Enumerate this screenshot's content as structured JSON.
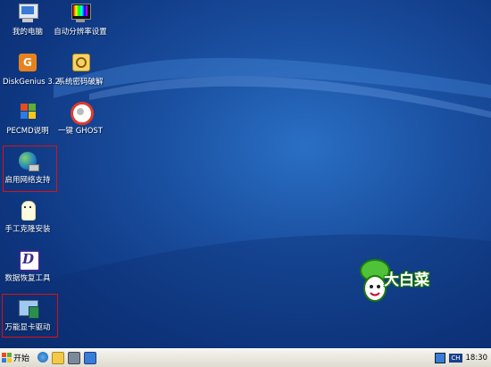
{
  "desktop": {
    "icons": [
      {
        "label": "我的电脑",
        "icon": "my-computer-icon"
      },
      {
        "label": "自动分辨率设置",
        "icon": "resolution-icon"
      },
      {
        "label": "DiskGenius 3.2",
        "icon": "diskgenius-icon"
      },
      {
        "label": "系统密码破解",
        "icon": "password-icon"
      },
      {
        "label": "PECMD说明",
        "icon": "windows-flag-icon"
      },
      {
        "label": "一键 GHOST",
        "icon": "ghost-icon"
      },
      {
        "label": "启用网络支持",
        "icon": "network-globe-icon"
      },
      {
        "label": "手工克隆安装",
        "icon": "clone-ghost-icon"
      },
      {
        "label": "数据恢复工具",
        "icon": "data-recovery-icon"
      },
      {
        "label": "万能显卡驱动",
        "icon": "display-driver-icon"
      }
    ],
    "logo_text": "大白菜"
  },
  "taskbar": {
    "start_label": "开始",
    "quick_launch": [
      "ie-icon",
      "folder-icon",
      "media-icon",
      "desktop-icon"
    ],
    "tray_icons": [
      "tray-app-icon"
    ],
    "ime_label": "CH",
    "clock": "18:30"
  },
  "colors": {
    "desktop_blue": "#1a4fa0",
    "highlight_red": "#e01010",
    "taskbar": "#e9e7dc"
  }
}
